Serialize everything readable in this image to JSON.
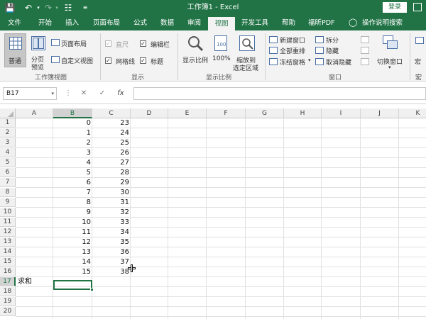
{
  "window": {
    "title": "工作簿1  -  Excel",
    "login_label": "登录"
  },
  "tabs": [
    "文件",
    "开始",
    "插入",
    "页面布局",
    "公式",
    "数据",
    "审阅",
    "视图",
    "开发工具",
    "帮助",
    "福昕PDF",
    "操作说明搜索"
  ],
  "active_tab": "视图",
  "ribbon": {
    "workbook_views": {
      "group_label": "工作簿视图",
      "normal": "普通",
      "page_break_1": "分页",
      "page_break_2": "预览",
      "page_layout": "页面布局",
      "custom_views": "自定义视图"
    },
    "show": {
      "group_label": "显示",
      "ruler": "直尺",
      "formula_bar": "编辑栏",
      "gridlines": "网格线",
      "headings": "标题"
    },
    "zoom": {
      "group_label": "显示比例",
      "zoom": "显示比例",
      "zoom_100": "100%",
      "zoom_sel_1": "缩放到",
      "zoom_sel_2": "选定区域"
    },
    "window": {
      "group_label": "窗口",
      "new_window": "新建窗口",
      "arrange_all": "全部重排",
      "freeze_panes": "冻结窗格",
      "split": "拆分",
      "hide": "隐藏",
      "unhide": "取消隐藏",
      "switch_windows": "切换窗口",
      "macros_partial": "宏"
    }
  },
  "formula_bar": {
    "name_box": "B17",
    "fx": "fx",
    "formula": ""
  },
  "sheet": {
    "columns": [
      "A",
      "B",
      "C",
      "D",
      "E",
      "F",
      "G",
      "H",
      "I",
      "J",
      "K"
    ],
    "rows": [
      "1",
      "2",
      "3",
      "4",
      "5",
      "6",
      "7",
      "8",
      "9",
      "10",
      "11",
      "12",
      "13",
      "14",
      "15",
      "16",
      "17",
      "18",
      "19",
      "20"
    ],
    "col_b": [
      "0",
      "1",
      "2",
      "3",
      "4",
      "5",
      "6",
      "7",
      "8",
      "9",
      "10",
      "11",
      "12",
      "13",
      "14",
      "15"
    ],
    "col_c": [
      "23",
      "24",
      "25",
      "26",
      "27",
      "28",
      "29",
      "30",
      "31",
      "32",
      "33",
      "34",
      "35",
      "36",
      "37",
      "38"
    ],
    "a17": "求和",
    "selected_cell": "B17"
  },
  "colors": {
    "brand": "#217346",
    "ribbon_bg": "#f3f3f3",
    "header_bg": "#f0f0f0",
    "gridline": "#e1e1e1"
  }
}
